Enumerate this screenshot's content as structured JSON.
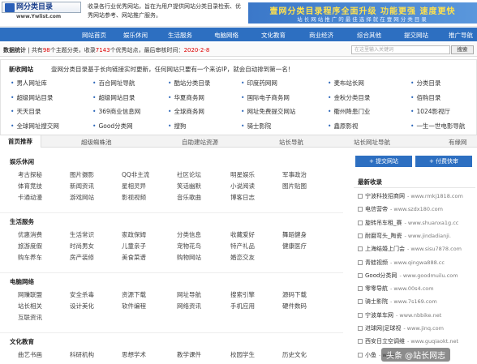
{
  "header": {
    "logo_title": "网分类目录",
    "logo_domain": "www.Ywlist.com",
    "intro": "收录各行业优秀网站，旨在为用户提供网站分类目录检索、优秀网站参考、网站推广服务。",
    "banner_line1": "壹网分类目录程序全面升级 功能更强 速度更快",
    "banner_line2": "站长网站推广的最佳选择就在壹网分类目录"
  },
  "nav": [
    "网站首页",
    "娱乐休闲",
    "生活服务",
    "电脑网络",
    "文化教育",
    "商业经济",
    "综合其他",
    "提交网站",
    "推广导航"
  ],
  "stats": {
    "label": "数据统计",
    "text_a": "共有",
    "category_count": "98",
    "text_b": "个主题分类，收录",
    "site_count": "7143",
    "text_c": "个优秀站点，最后审核时间：",
    "last_time": "2020-2-8",
    "search_placeholder": "在这里输入关键词",
    "search_button": "搜索"
  },
  "new_sites": {
    "label": "新收网站",
    "notice": "壹网分类目录基于长向链接实时更新，任何网站只要有一个来访IP，就会自动排到第一名！",
    "rows": [
      [
        "男人网址库",
        "百合网址导航",
        "酷站分类目录",
        "印度药网网",
        "麦布站长网",
        "分类目录"
      ],
      [
        "超级网站目录",
        "超级网站目录",
        "华夏商务网",
        "国际电子商务网",
        "金秋分类目录",
        "佰购目录"
      ],
      [
        "天天目录",
        "369商业信息网",
        "全球商务网",
        "网址免费提交网站",
        "衢州降患门业",
        "1024影视厅"
      ],
      [
        "全球网址搜交网",
        "Good分类网",
        "搜狗",
        "骑士影院",
        "鑫原影视",
        "一生一世电影导航"
      ]
    ]
  },
  "tabs": [
    "首页推荐",
    "超级蜘蛛池",
    "自助建站资源",
    "站长导航",
    "站长网址导航",
    "有缘网"
  ],
  "categories": [
    {
      "name": "娱乐休闲",
      "links": [
        [
          "考古探秘",
          "图片摄影",
          "QQ非主流",
          "社区论坛",
          "明星娱乐",
          "军事政治"
        ],
        [
          "体育竞技",
          "新闻资讯",
          "星相灵异",
          "笑话幽默",
          "小说阅读",
          "图片贴图"
        ],
        [
          "卡通动漫",
          "游戏网站",
          "影视视频",
          "音乐歌曲",
          "博客日志",
          ""
        ]
      ]
    },
    {
      "name": "生活服务",
      "links": [
        [
          "优惠消费",
          "生活常识",
          "家政保姆",
          "分类信息",
          "收藏爱好",
          "舞蹈健身"
        ],
        [
          "旅游度假",
          "时尚男女",
          "儿童亲子",
          "宠物花鸟",
          "特产礼品",
          "健康医疗"
        ],
        [
          "购车养车",
          "房产装修",
          "美食菜谱",
          "购物网站",
          "婚恋交友",
          ""
        ]
      ]
    },
    {
      "name": "电脑网络",
      "links": [
        [
          "网赚联盟",
          "安全杀毒",
          "资源下载",
          "网址导航",
          "搜索引擎",
          "源码下载"
        ],
        [
          "站长相关",
          "设计美化",
          "软件编程",
          "网络资讯",
          "手机应用",
          "硬件数码"
        ],
        [
          "互联资讯",
          "",
          "",
          "",
          "",
          ""
        ]
      ]
    },
    {
      "name": "文化教育",
      "links": [
        [
          "曲艺书画",
          "科研机构",
          "思想学术",
          "教学课件",
          "校园学生",
          "历史文化"
        ]
      ]
    }
  ],
  "side": {
    "btn_submit": "+ 提交网站",
    "btn_paid": "+ 付费快审",
    "new_title": "最新收录",
    "items": [
      {
        "name": "宁波科技招商网",
        "url": "- www.rmkj1818.com"
      },
      {
        "name": "电信营帝",
        "url": "- www.szdx180.com"
      },
      {
        "name": "旋转吊车租_赛",
        "url": "- www.shuanxa1g.cc"
      },
      {
        "name": "耐磨弯头_陶瓷",
        "url": "- www.jindadianji."
      },
      {
        "name": "上海结婚上门会",
        "url": "- www.sisu7878.com"
      },
      {
        "name": "青蛙视频",
        "url": "- www.qingwa888.cc"
      },
      {
        "name": "Good分类网",
        "url": "- www.goodmuilu.com"
      },
      {
        "name": "零零导航",
        "url": "- www.00s4.com"
      },
      {
        "name": "骑士影院",
        "url": "- www.7s169.com"
      },
      {
        "name": "宁波单车网",
        "url": "- www.nbbike.net"
      },
      {
        "name": "进球网|足球视",
        "url": "- www.jinq.com"
      },
      {
        "name": "西安日立空调维",
        "url": "- www.guqiaokt.net"
      },
      {
        "name": "小鱼",
        "url": "- www"
      }
    ]
  },
  "watermark": "头条 @站长网志"
}
